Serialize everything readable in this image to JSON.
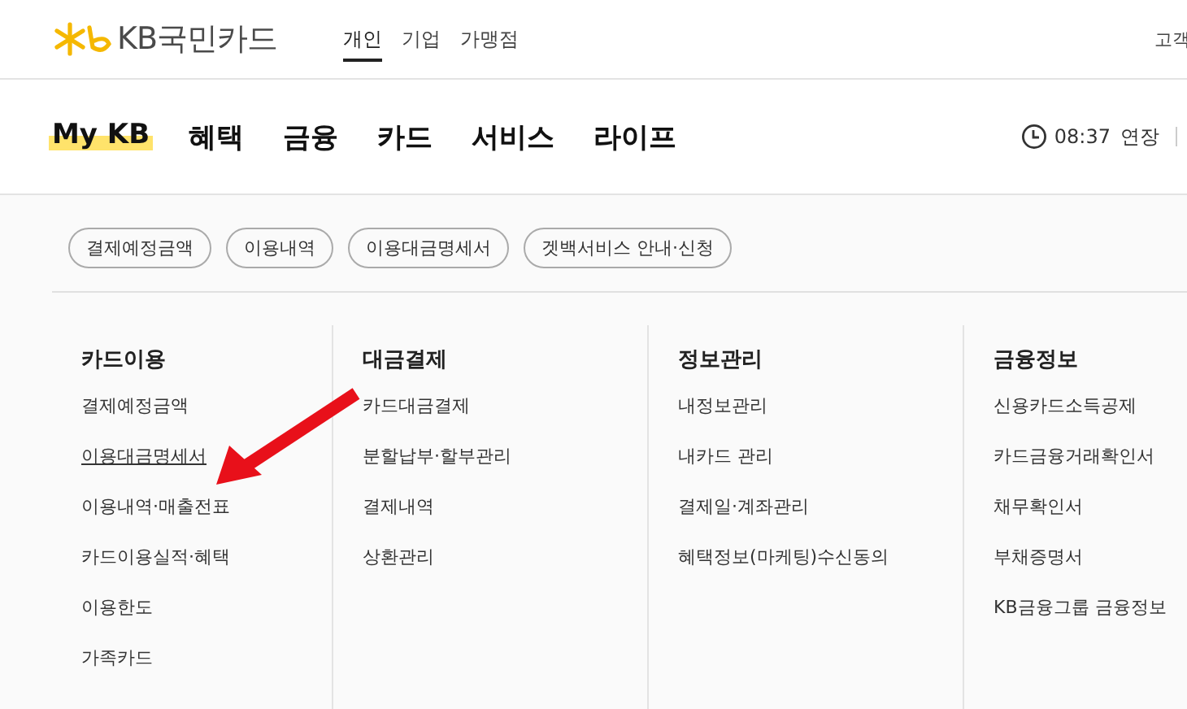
{
  "header": {
    "logo_text": "KB국민카드",
    "segments": [
      {
        "label": "개인",
        "selected": true
      },
      {
        "label": "기업",
        "selected": false
      },
      {
        "label": "가맹점",
        "selected": false
      }
    ],
    "right_link": "고객"
  },
  "nav": {
    "items": [
      {
        "label": "My KB",
        "selected": true
      },
      {
        "label": "혜택",
        "selected": false
      },
      {
        "label": "금융",
        "selected": false
      },
      {
        "label": "카드",
        "selected": false
      },
      {
        "label": "서비스",
        "selected": false
      },
      {
        "label": "라이프",
        "selected": false
      }
    ],
    "session_time": "08:37",
    "extend": "연장"
  },
  "quick_links": [
    "결제예정금액",
    "이용내역",
    "이용대금명세서",
    "겟백서비스 안내·신청"
  ],
  "menu_columns": [
    {
      "heading": "카드이용",
      "items": [
        {
          "label": "결제예정금액",
          "selected": false
        },
        {
          "label": "이용대금명세서",
          "selected": true
        },
        {
          "label": "이용내역·매출전표",
          "selected": false
        },
        {
          "label": "카드이용실적·혜택",
          "selected": false
        },
        {
          "label": "이용한도",
          "selected": false
        },
        {
          "label": "가족카드",
          "selected": false
        }
      ]
    },
    {
      "heading": "대금결제",
      "items": [
        {
          "label": "카드대금결제",
          "selected": false
        },
        {
          "label": "분할납부·할부관리",
          "selected": false
        },
        {
          "label": "결제내역",
          "selected": false
        },
        {
          "label": "상환관리",
          "selected": false
        }
      ]
    },
    {
      "heading": "정보관리",
      "items": [
        {
          "label": "내정보관리",
          "selected": false
        },
        {
          "label": "내카드 관리",
          "selected": false
        },
        {
          "label": "결제일·계좌관리",
          "selected": false
        },
        {
          "label": "혜택정보(마케팅)수신동의",
          "selected": false
        }
      ]
    },
    {
      "heading": "금융정보",
      "items": [
        {
          "label": "신용카드소득공제",
          "selected": false
        },
        {
          "label": "카드금융거래확인서",
          "selected": false
        },
        {
          "label": "채무확인서",
          "selected": false
        },
        {
          "label": "부채증명서",
          "selected": false
        },
        {
          "label": "KB금융그룹 금융정보",
          "selected": false
        }
      ]
    }
  ]
}
